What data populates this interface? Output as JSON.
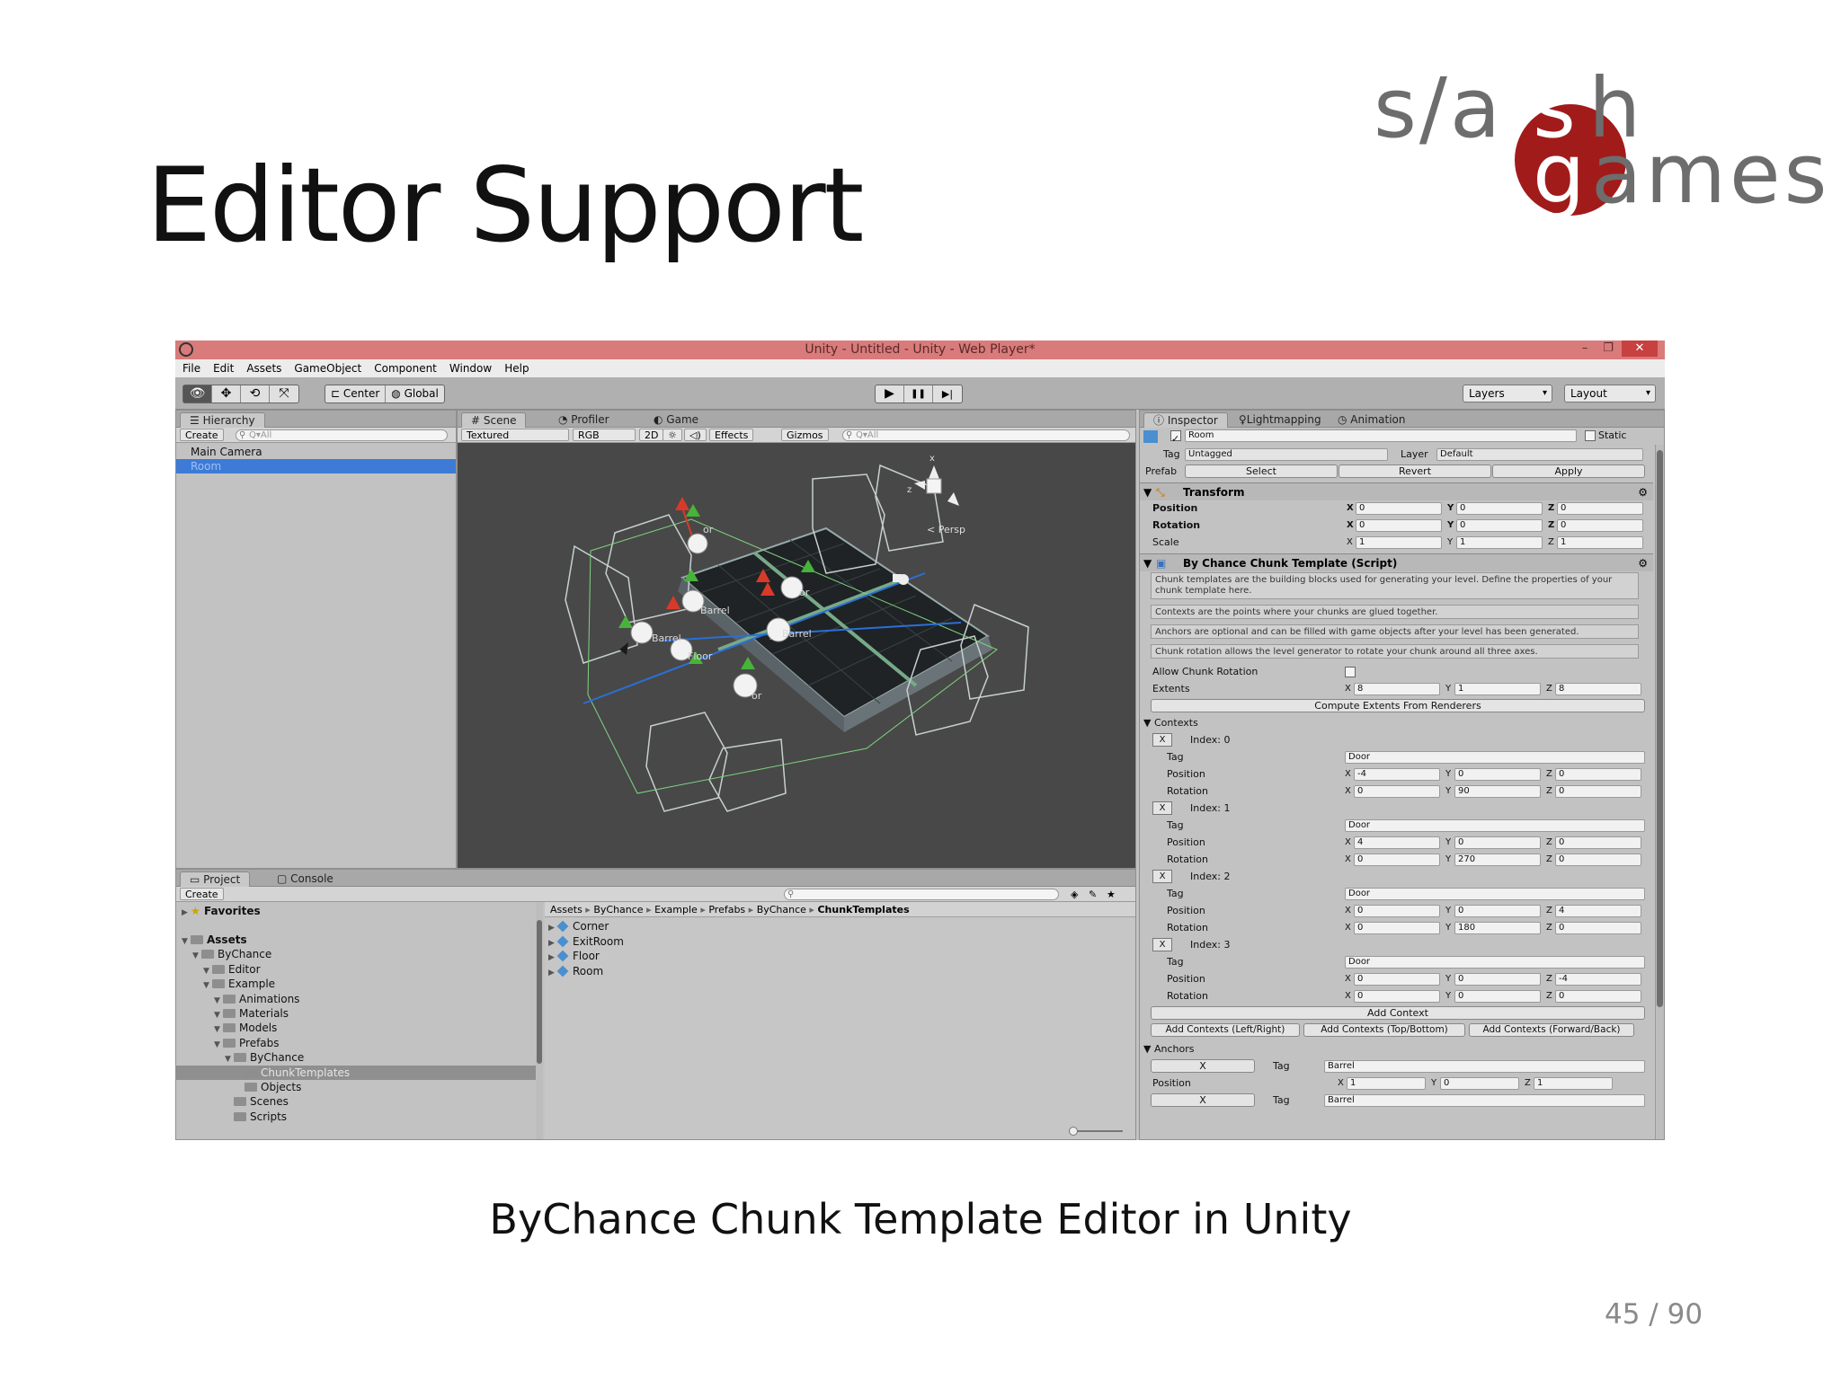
{
  "slide": {
    "title": "Editor Support",
    "caption": "ByChance Chunk Template Editor in Unity",
    "page": "45 / 90",
    "logo": {
      "line1": "s/a h",
      "line2": "ames",
      "mark_top": "s",
      "mark_bottom": "g"
    }
  },
  "colors": {
    "titlebar": "#d97b7b",
    "logo_red": "#a11b1b",
    "logo_grey": "#6d6d6d",
    "selection": "#3d7bd6",
    "scene_bg": "#484848"
  },
  "window": {
    "title": "Unity - Untitled - Unity - Web Player*"
  },
  "menu": [
    "File",
    "Edit",
    "Assets",
    "GameObject",
    "Component",
    "Window",
    "Help"
  ],
  "toolbar": {
    "tools": [
      "eye-icon",
      "move-icon",
      "rotate-icon",
      "scale-icon"
    ],
    "center": "Center",
    "global": "Global",
    "play": "▶",
    "pause": "❚❚",
    "step": "▶|",
    "layers": "Layers",
    "layout": "Layout"
  },
  "hierarchy": {
    "tab": "Hierarchy",
    "create": "Create",
    "search": "Q▾All",
    "items": [
      "Main Camera",
      "Room"
    ]
  },
  "scene": {
    "tabs": [
      "Scene",
      "Profiler",
      "Game"
    ],
    "render_mode": "Textured",
    "color_mode": "RGB",
    "mode_2d": "2D",
    "effects": "Effects",
    "gizmos": "Gizmos",
    "search": "Q▾All",
    "persp": "Persp",
    "labels": [
      "or",
      "or",
      "or",
      "Barrel",
      "Barrel",
      "Barrel",
      "Floor"
    ]
  },
  "project": {
    "tabs": [
      "Project",
      "Console"
    ],
    "create": "Create",
    "favorites": "Favorites",
    "tree": [
      {
        "label": "Assets",
        "indent": 0,
        "bold": true
      },
      {
        "label": "ByChance",
        "indent": 1
      },
      {
        "label": "Editor",
        "indent": 2
      },
      {
        "label": "Example",
        "indent": 2
      },
      {
        "label": "Animations",
        "indent": 3
      },
      {
        "label": "Materials",
        "indent": 3
      },
      {
        "label": "Models",
        "indent": 3
      },
      {
        "label": "Prefabs",
        "indent": 3
      },
      {
        "label": "ByChance",
        "indent": 4
      },
      {
        "label": "ChunkTemplates",
        "indent": 5,
        "selected": true
      },
      {
        "label": "Objects",
        "indent": 5
      },
      {
        "label": "Scenes",
        "indent": 4
      },
      {
        "label": "Scripts",
        "indent": 4
      }
    ],
    "breadcrumb": [
      "Assets",
      "ByChance",
      "Example",
      "Prefabs",
      "ByChance",
      "ChunkTemplates"
    ],
    "files": [
      "Corner",
      "ExitRoom",
      "Floor",
      "Room"
    ]
  },
  "inspector": {
    "tabs": [
      "Inspector",
      "Lightmapping",
      "Animation"
    ],
    "object_name": "Room",
    "static": "Static",
    "tag_label": "Tag",
    "tag": "Untagged",
    "layer_label": "Layer",
    "layer": "Default",
    "prefab_label": "Prefab",
    "prefab_buttons": [
      "Select",
      "Revert",
      "Apply"
    ],
    "transform": {
      "title": "Transform",
      "rows": [
        {
          "label": "Position",
          "x": "0",
          "y": "0",
          "z": "0"
        },
        {
          "label": "Rotation",
          "x": "0",
          "y": "0",
          "z": "0"
        },
        {
          "label": "Scale",
          "x": "1",
          "y": "1",
          "z": "1"
        }
      ]
    },
    "script": {
      "title": "By Chance Chunk Template (Script)",
      "help": [
        "Chunk templates are the building blocks used for generating your level. Define the properties of your chunk template here.",
        "Contexts are the points where your chunks are glued together.",
        "Anchors are optional and can be filled with game objects after your level has been generated.",
        "Chunk rotation allows the level generator to rotate your chunk around all three axes."
      ],
      "allow_rotation": "Allow Chunk Rotation",
      "extents": {
        "label": "Extents",
        "x": "8",
        "y": "1",
        "z": "8"
      },
      "compute_button": "Compute Extents From Renderers",
      "contexts_label": "Contexts",
      "contexts": [
        {
          "index": "Index: 0",
          "tag": "Door",
          "pos": [
            "-4",
            "0",
            "0"
          ],
          "rot": [
            "0",
            "90",
            "0"
          ]
        },
        {
          "index": "Index: 1",
          "tag": "Door",
          "pos": [
            "4",
            "0",
            "0"
          ],
          "rot": [
            "0",
            "270",
            "0"
          ]
        },
        {
          "index": "Index: 2",
          "tag": "Door",
          "pos": [
            "0",
            "0",
            "4"
          ],
          "rot": [
            "0",
            "180",
            "0"
          ]
        },
        {
          "index": "Index: 3",
          "tag": "Door",
          "pos": [
            "0",
            "0",
            "-4"
          ],
          "rot": [
            "0",
            "0",
            "0"
          ]
        }
      ],
      "field_labels": {
        "tag": "Tag",
        "position": "Position",
        "rotation": "Rotation",
        "x": "X",
        "y": "Y",
        "z": "Z",
        "remove": "X"
      },
      "add_context": "Add Context",
      "add_buttons": [
        "Add Contexts (Left/Right)",
        "Add Contexts (Top/Bottom)",
        "Add Contexts (Forward/Back)"
      ],
      "anchors_label": "Anchors",
      "anchors": [
        {
          "tag": "Barrel",
          "pos": [
            "1",
            "0",
            "1"
          ]
        },
        {
          "tag": "Barrel"
        }
      ]
    }
  }
}
